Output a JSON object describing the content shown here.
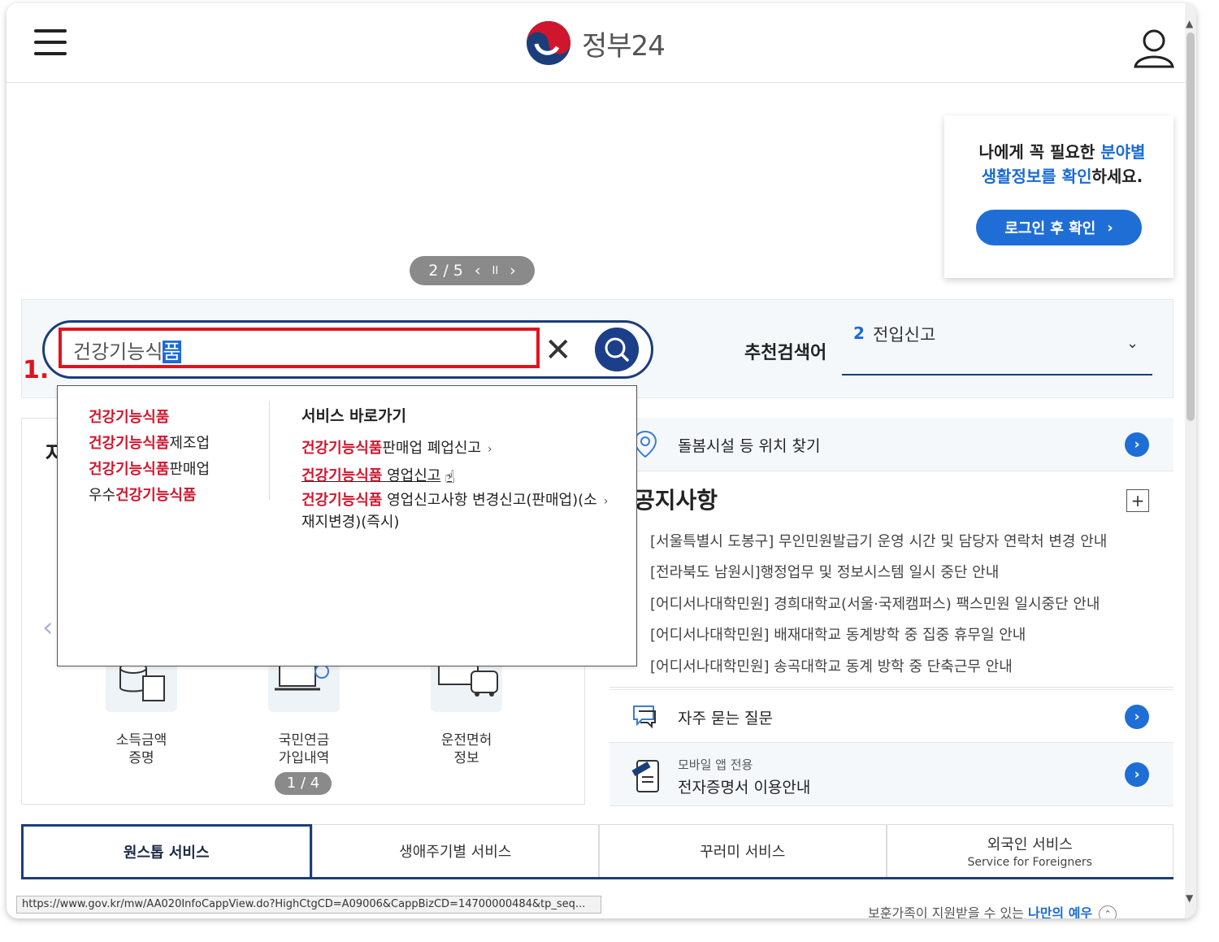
{
  "header": {
    "logo_text": "정부24",
    "menu_icon": "hamburger-icon",
    "user_icon": "user-icon"
  },
  "banner": {
    "pager_text": "2 / 5",
    "prev": "‹",
    "pause": "II",
    "next": "›"
  },
  "login_box": {
    "line1_pre": "나에게 꼭 필요한 ",
    "line1_hl": "분야별",
    "line2_hl": "생활정보를 확인",
    "line2_post": "하세요.",
    "button_label": "로그인 후 확인",
    "button_arrow": "›"
  },
  "search": {
    "value_plain": "건강기능식",
    "value_selected": "품",
    "step_label": "1.",
    "recommend_label": "추천검색어",
    "recommend_num": "2",
    "recommend_term": "전입신고"
  },
  "autocomplete": {
    "suggestions": [
      {
        "pre": "",
        "match": "건강기능식품",
        "post": ""
      },
      {
        "pre": "",
        "match": "건강기능식품",
        "post": "제조업"
      },
      {
        "pre": "",
        "match": "건강기능식품",
        "post": "판매업"
      },
      {
        "pre": "우수",
        "match": "건강기능식품",
        "post": ""
      }
    ],
    "service_header": "서비스 바로가기",
    "services": [
      {
        "match": "건강기능식품",
        "post": "판매업 폐업신고"
      },
      {
        "match": "건강기능식품",
        "post": " 영업신고"
      },
      {
        "match": "건강기능식품",
        "post": " 영업신고사항 변경신고(판매업)(소",
        "line2": "재지변경)(즉시)"
      }
    ]
  },
  "left_card": {
    "title_fragment": "자",
    "services": [
      {
        "line1": "소득금액",
        "line2": "증명"
      },
      {
        "line1": "국민연금",
        "line2": "가입내역"
      },
      {
        "line1": "운전면허",
        "line2": "정보"
      }
    ],
    "pager_text": "1 / 4"
  },
  "right": {
    "location_label": "돌봄시설 등 위치 찾기",
    "notice_title": "공지사항",
    "notice_plus": "+",
    "notices": [
      "[서울특별시 도봉구] 무인민원발급기 운영 시간 및 담당자 연락처 변경 안내",
      "[전라북도 남원시]행정업무 및 정보시스템 일시 중단 안내",
      "[어디서나대학민원] 경희대학교(서울·국제캠퍼스) 팩스민원 일시중단 안내",
      "[어디서나대학민원] 배재대학교 동계방학 중 집중 휴무일 안내",
      "[어디서나대학민원] 송곡대학교 동계 방학 중 단축근무 안내"
    ],
    "faq_label": "자주 묻는 질문",
    "mobile_sub": "모바일 앱 전용",
    "mobile_main": "전자증명서 이용안내"
  },
  "tabs": [
    {
      "label": "원스톱 서비스",
      "sub": ""
    },
    {
      "label": "생애주기별 서비스",
      "sub": ""
    },
    {
      "label": "꾸러미 서비스",
      "sub": ""
    },
    {
      "label": "외국인 서비스",
      "sub": "Service for Foreigners"
    }
  ],
  "bottom": {
    "pre": "보훈가족이 지원받을 수 있는 ",
    "hl": "나만의 예우"
  },
  "status_url": "https://www.gov.kr/mw/AA020InfoCappView.do?HighCtgCD=A09006&CappBizCD=14700000484&tp_seq...",
  "colors": {
    "accent_blue": "#1e6ed6",
    "navy": "#1b3e7a",
    "highlight_red": "#e0141e"
  }
}
